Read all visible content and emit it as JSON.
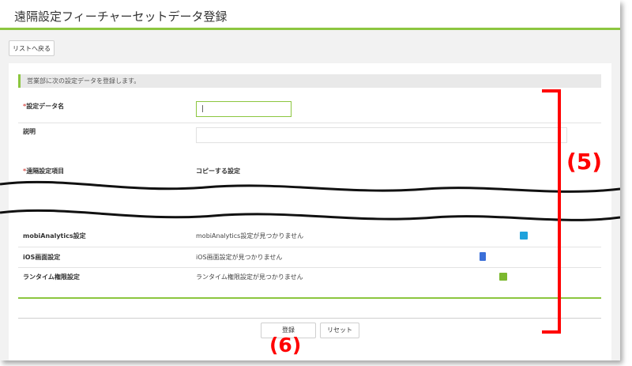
{
  "header": {
    "title": "遠隔設定フィーチャーセットデータ登録"
  },
  "toolbar": {
    "back_label": "リストへ戻る"
  },
  "notice": {
    "text": "営業部に次の設定データを登録します。"
  },
  "form": {
    "name_label": "設定データ名",
    "name_value": "|",
    "description_label": "説明",
    "description_value": "",
    "required_mark": "*"
  },
  "columns": {
    "item": "遠隔設定項目",
    "copy": "コピーする設定"
  },
  "rows": [
    {
      "label": "mobiAnalytics設定",
      "value": "mobiAnalytics設定が見つかりません",
      "icon": "analytics-icon",
      "icon_color": "#1fa2dc"
    },
    {
      "label": "iOS画面設定",
      "value": "iOS画面設定が見つかりません",
      "icon": "ios-screen-icon",
      "icon_color": "#3b6fd8"
    },
    {
      "label": "ランタイム権限設定",
      "value": "ランタイム権限設定が見つかりません",
      "icon": "runtime-permission-icon",
      "icon_color": "#7cb82f"
    }
  ],
  "actions": {
    "register_label": "登録",
    "reset_label": "リセット"
  },
  "annotations": {
    "section_label": "(5)",
    "button_label": "(6)",
    "color": "#ff0000"
  },
  "theme": {
    "accent": "#8cc63f"
  }
}
